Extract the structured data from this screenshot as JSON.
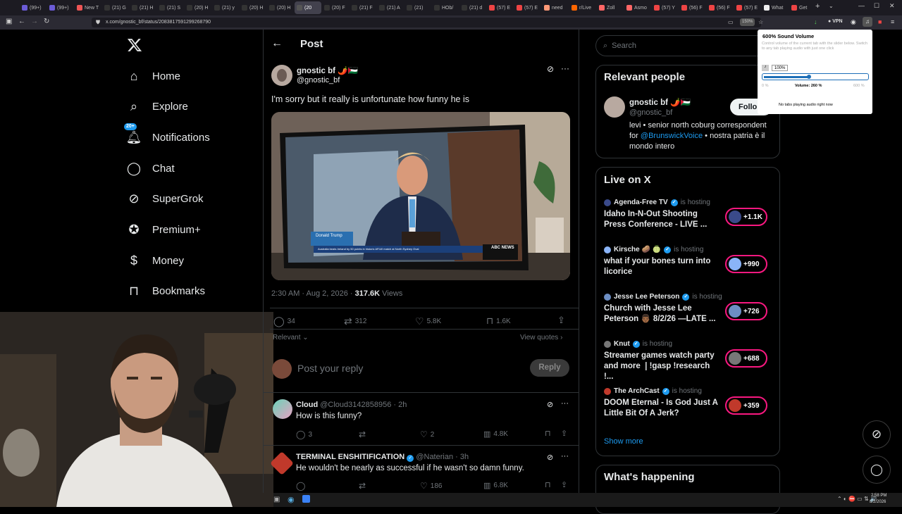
{
  "browser": {
    "tabs": [
      "(99+)",
      "(99+)",
      "New T",
      "(21) G",
      "(21) H",
      "(21) S",
      "(20) H",
      "(21) y",
      "(20) H",
      "(20) H",
      "(20",
      "(20) F",
      "(21) F",
      "(21) A",
      "(21)",
      "HOb/",
      "(21) d",
      "(57) E",
      "(57) E",
      "need",
      "r/Live",
      "Zoll",
      "Asmo",
      "(57) Y",
      "(56) F",
      "(56) F",
      "(57) E",
      "What",
      "Get"
    ],
    "url": "x.com/gnostic_bf/status/2083817591299268790",
    "zoom": "150%",
    "vpn": "VPN"
  },
  "sidebar": {
    "items": [
      {
        "label": "Home",
        "icon": "home-icon"
      },
      {
        "label": "Explore",
        "icon": "search-icon"
      },
      {
        "label": "Notifications",
        "icon": "bell-icon",
        "badge": "20+"
      },
      {
        "label": "Chat",
        "icon": "chat-icon"
      },
      {
        "label": "SuperGrok",
        "icon": "grok-icon"
      },
      {
        "label": "Premium+",
        "icon": "verified-icon"
      },
      {
        "label": "Money",
        "icon": "dollar-icon"
      },
      {
        "label": "Bookmarks",
        "icon": "bookmark-icon"
      }
    ]
  },
  "post": {
    "header": "Post",
    "author_name": "gnostic bf 🌶️🇵🇸",
    "author_handle": "@gnostic_bf",
    "text": "I'm sorry but it really is unfortunate how funny he is",
    "media_banner_name": "Donald Trump",
    "media_banner_sub": "Australia beats Ireland by 50 points in historic AFLW match at North Sydney Oval",
    "media_network": "ABC NEWS",
    "timestamp": "2:30 AM · Aug 2, 2026 · ",
    "views": "317.6K",
    "views_label": " Views",
    "replies": "34",
    "reposts": "312",
    "likes": "5.8K",
    "bookmarks": "1.6K",
    "sort": "Relevant",
    "view_quotes": "View quotes",
    "reply_placeholder": "Post your reply",
    "reply_button": "Reply"
  },
  "replies": [
    {
      "name": "Cloud",
      "handle": "@Cloud3142858956 · 2h",
      "text": "How is this funny?",
      "replies": "3",
      "reposts": "",
      "likes": "2",
      "views": "4.8K"
    },
    {
      "name": "TERMINAL ENSHITIFICATION",
      "handle": "@Naterian · 3h",
      "text": "He wouldn't be nearly as successful if he wasn't so damn funny.",
      "replies": "",
      "reposts": "",
      "likes": "186",
      "views": "6.8K"
    }
  ],
  "search": {
    "placeholder": "Search"
  },
  "relevant": {
    "title": "Relevant people",
    "name": "gnostic bf 🌶️🇵🇸",
    "handle": "@gnostic_bf",
    "follow": "Follo",
    "bio_pre": "levi • senior north coburg correspondent for ",
    "bio_link": "@BrunswickVoice",
    "bio_post": " • nostra patria è il mondo intero"
  },
  "live": {
    "title": "Live on X",
    "items": [
      {
        "host": "Agenda-Free TV",
        "status": "is hosting",
        "title": "Idaho In-N-Out Shooting Press Conference - LIVE ...",
        "count": "+1.1K",
        "color": "#3a4a8a"
      },
      {
        "host": "Kirsche 🥔 🍈",
        "status": "is hosting",
        "title": "what if your bones turn into licorice",
        "count": "+990",
        "color": "#8ab4f8"
      },
      {
        "host": "Jesse Lee Peterson",
        "status": "is hosting",
        "title": "Church with Jesse Lee Peterson 👨🏾 8/2/26 —LATE ...",
        "count": "+726",
        "color": "#6d8ec4"
      },
      {
        "host": "Knut",
        "status": "is hosting",
        "title": "Streamer games watch party and more ❘!gasp !research !...",
        "count": "+688",
        "color": "#777"
      },
      {
        "host": "The ArchCast",
        "status": "is hosting",
        "title": "DOOM Eternal - Is God Just A Little Bit Of A Jerk?",
        "count": "+359",
        "color": "#c0392b"
      }
    ],
    "show_more": "Show more"
  },
  "happening": {
    "title": "What's happening"
  },
  "popup": {
    "title": "600% Sound Volume",
    "desc": "Control volume of the current tab with the slider below. Switch to any tab playing audio with just one click",
    "current": "100%",
    "min": "0 %",
    "volume": "Volume: 260 %",
    "max": "600 %",
    "volume_fraction": 0.43,
    "no_tabs": "No tabs playing audio right now"
  },
  "clock": {
    "time": "2:58 PM",
    "date": "8/2/2026"
  },
  "colors": {
    "accent": "#1d9bf0",
    "live": "#f91880",
    "bg": "#000000",
    "border": "#2f3336"
  }
}
